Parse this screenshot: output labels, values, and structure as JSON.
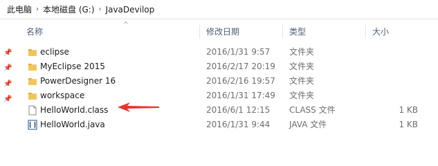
{
  "breadcrumb": [
    "此电脑",
    "本地磁盘 (G:)",
    "JavaDevilop"
  ],
  "columns": {
    "name": "名称",
    "date": "修改日期",
    "type": "类型",
    "size": "大小"
  },
  "files": [
    {
      "name": "eclipse",
      "date": "2016/1/31 9:57",
      "type": "文件夹",
      "size": "",
      "icon": "folder-icon"
    },
    {
      "name": "MyEclipse 2015",
      "date": "2016/2/17 20:19",
      "type": "文件夹",
      "size": "",
      "icon": "folder-icon"
    },
    {
      "name": "PowerDesigner 16",
      "date": "2016/2/16 19:57",
      "type": "文件夹",
      "size": "",
      "icon": "folder-icon"
    },
    {
      "name": "workspace",
      "date": "2016/1/31 17:49",
      "type": "文件夹",
      "size": "",
      "icon": "folder-icon"
    },
    {
      "name": "HelloWorld.class",
      "date": "2016/6/1 12:15",
      "type": "CLASS 文件",
      "size": "1 KB",
      "icon": "file-icon"
    },
    {
      "name": "HelloWorld.java",
      "date": "2016/1/31 9:44",
      "type": "JAVA 文件",
      "size": "1 KB",
      "icon": "java-file-icon"
    }
  ],
  "colors": {
    "folder": "#f2c55c",
    "folder_dark": "#e0a92c",
    "header_text": "#4c607a",
    "arrow": "#e8322f"
  }
}
